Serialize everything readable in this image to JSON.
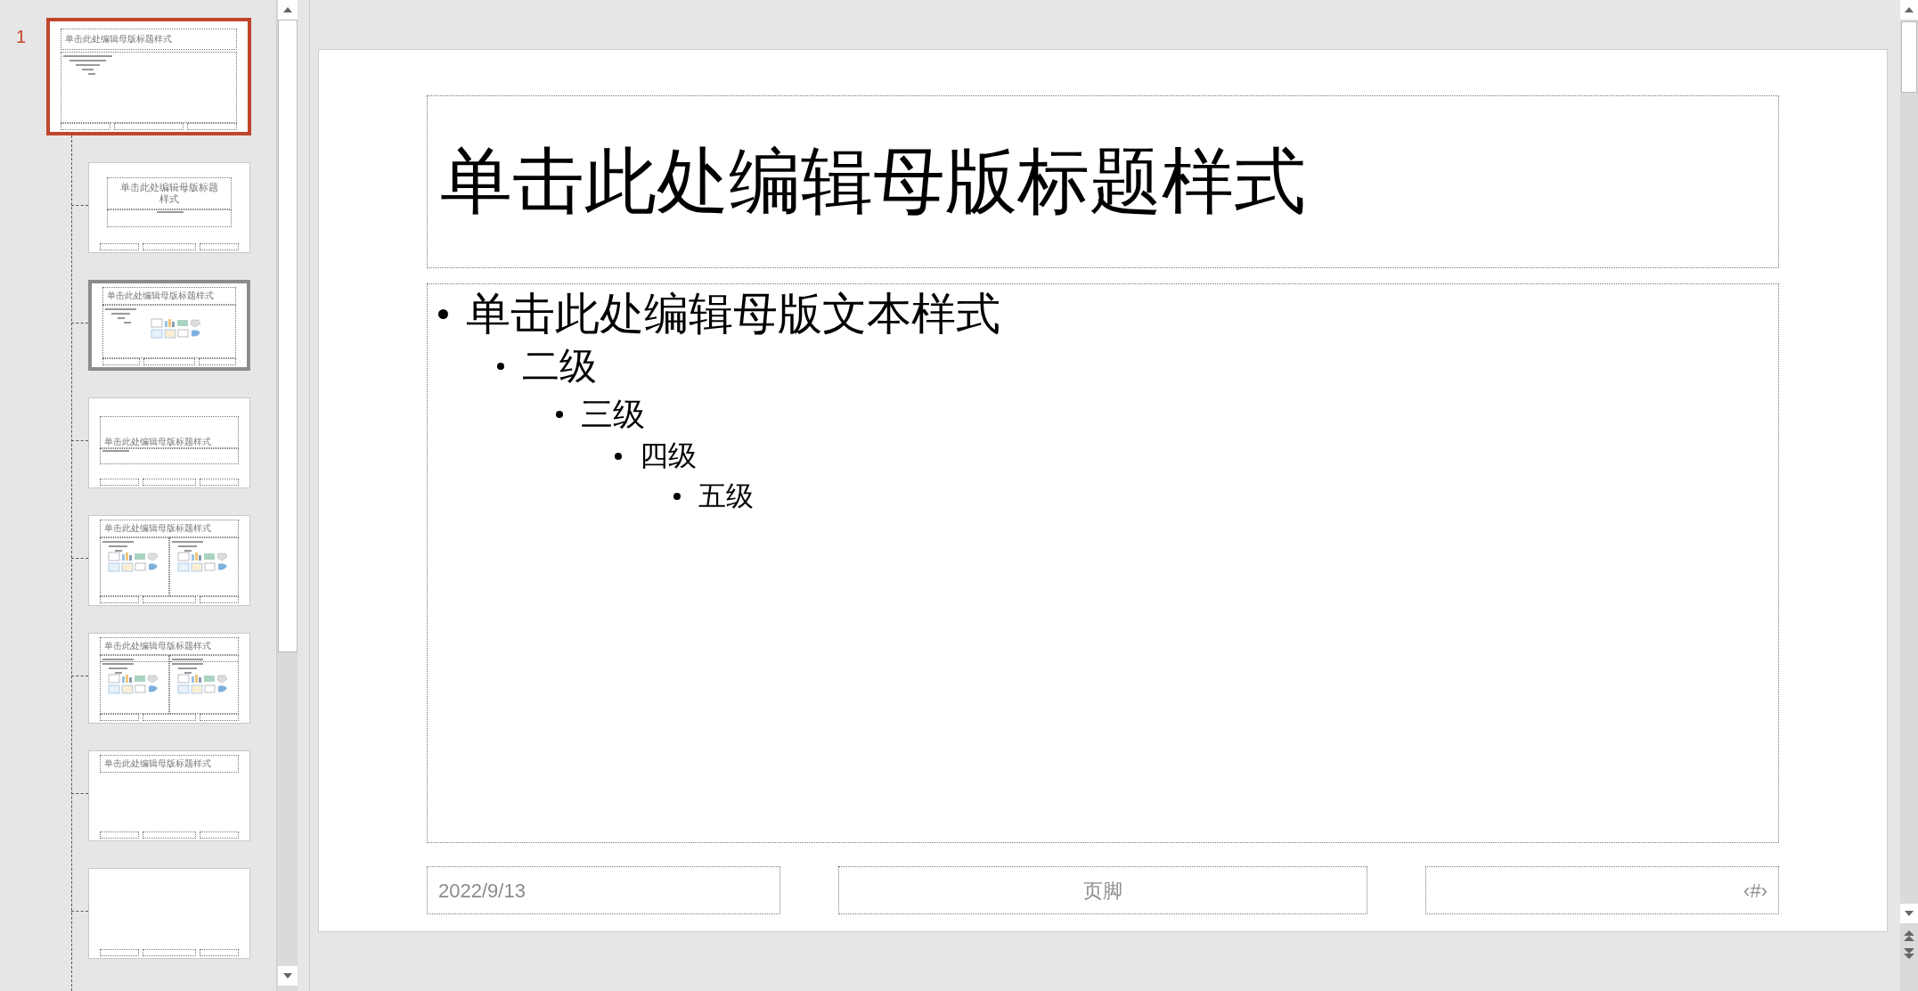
{
  "thumbnails": [
    {
      "kind": "master",
      "number": "1",
      "title": "单击此处编辑母版标题样式",
      "selected": true,
      "highlighted": false
    },
    {
      "kind": "title",
      "title": "单击此处编辑母版标题样式",
      "selected": false,
      "highlighted": false
    },
    {
      "kind": "content",
      "title": "单击此处编辑母版标题样式",
      "selected": false,
      "highlighted": true
    },
    {
      "kind": "section",
      "title": "单击此处编辑母版标题样式",
      "selected": false,
      "highlighted": false
    },
    {
      "kind": "two-content",
      "title": "单击此处编辑母版标题样式",
      "selected": false,
      "highlighted": false
    },
    {
      "kind": "comparison",
      "title": "单击此处编辑母版标题样式",
      "selected": false,
      "highlighted": false
    },
    {
      "kind": "title-only",
      "title": "单击此处编辑母版标题样式",
      "selected": false,
      "highlighted": false
    },
    {
      "kind": "blank",
      "selected": false,
      "highlighted": false
    }
  ],
  "slide": {
    "title": "单击此处编辑母版标题样式",
    "body": [
      {
        "text": "单击此处编辑母版文本样式",
        "children": [
          {
            "text": "二级",
            "children": [
              {
                "text": "三级",
                "children": [
                  {
                    "text": "四级",
                    "children": [
                      {
                        "text": "五级"
                      }
                    ]
                  }
                ]
              }
            ]
          }
        ]
      }
    ],
    "date": "2022/9/13",
    "footer": "页脚",
    "slide_number": "‹#›"
  }
}
